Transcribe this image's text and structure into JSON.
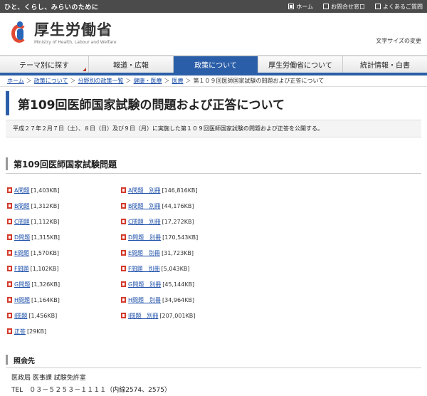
{
  "topbar": {
    "tagline": "ひと、くらし、みらいのために",
    "links": [
      "ホーム",
      "お問合せ窓口",
      "よくあるご質問"
    ]
  },
  "header": {
    "logo_jp": "厚生労働省",
    "logo_en": "Ministry of Health, Labour and Welfare",
    "textsize": "文字サイズの変更"
  },
  "nav": {
    "items": [
      "テーマ別に探す",
      "報道・広報",
      "政策について",
      "厚生労働省について",
      "統計情報・白書"
    ]
  },
  "breadcrumb": {
    "items": [
      "ホーム",
      "政策について",
      "分野別の政策一覧",
      "健康・医療",
      "医療"
    ],
    "current": "第１０９回医師国家試験の問題および正答について"
  },
  "page": {
    "title": "第109回医師国家試験の問題および正答について",
    "intro": "平成２７年２月７日（土）、８日（日）及び９日（月）に実施した第１０９回医師国家試験の問題および正答を公開する。"
  },
  "section": {
    "title": "第109回医師国家試験問題"
  },
  "downloads": {
    "left": [
      {
        "label": "A問題",
        "size": "[1,403KB]"
      },
      {
        "label": "B問題",
        "size": "[1,312KB]"
      },
      {
        "label": "C問題",
        "size": "[1,112KB]"
      },
      {
        "label": "D問題",
        "size": "[1,315KB]"
      },
      {
        "label": "E問題",
        "size": "[1,570KB]"
      },
      {
        "label": "F問題",
        "size": "[1,102KB]"
      },
      {
        "label": "G問題",
        "size": "[1,326KB]"
      },
      {
        "label": "H問題",
        "size": "[1,164KB]"
      },
      {
        "label": "I問題",
        "size": "[1,456KB]"
      },
      {
        "label": "正答",
        "size": "[29KB]"
      }
    ],
    "right": [
      {
        "label": "A問題　別冊",
        "size": "[146,816KB]"
      },
      {
        "label": "B問題　別冊",
        "size": "[44,176KB]"
      },
      {
        "label": "C問題　別冊",
        "size": "[17,272KB]"
      },
      {
        "label": "D問題　別冊",
        "size": "[170,543KB]"
      },
      {
        "label": "E問題　別冊",
        "size": "[31,723KB]"
      },
      {
        "label": "F問題　別冊",
        "size": "[5,043KB]"
      },
      {
        "label": "G問題　別冊",
        "size": "[45,144KB]"
      },
      {
        "label": "H問題　別冊",
        "size": "[34,964KB]"
      },
      {
        "label": "I問題　別冊",
        "size": "[207,001KB]"
      }
    ]
  },
  "contact": {
    "title": "照会先",
    "dept": "医政局 医事課 試験免許室",
    "tel": "TEL　０３－５２５３－１１１１（内線2574、2575）"
  },
  "colors": {
    "nav_active": "#2b5ea8",
    "link": "#1a4da8",
    "pdf": "#d43c2c"
  }
}
